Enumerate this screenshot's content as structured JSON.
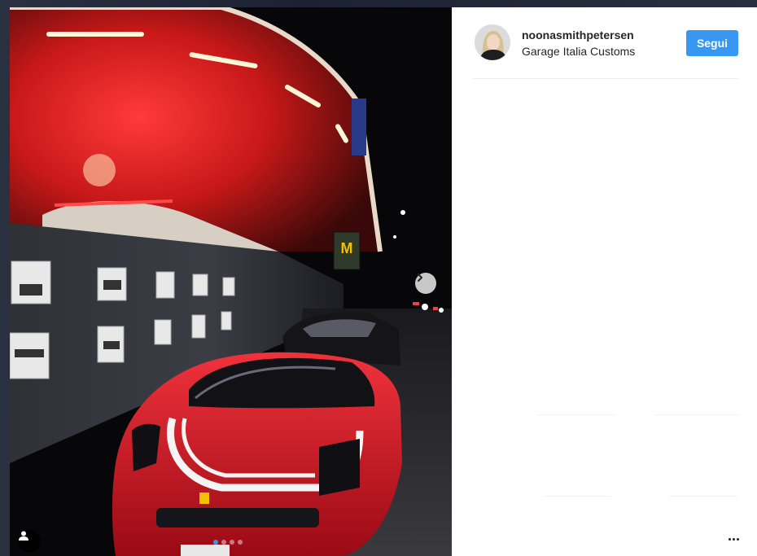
{
  "post": {
    "username": "noonasmithpetersen",
    "location": "Garage Italia Customs",
    "follow_label": "Segui"
  },
  "photo": {
    "description_icons": [
      "tag-user-icon",
      "next-arrow-icon",
      "more-options-icon"
    ],
    "carousel": {
      "total": 4,
      "active_index": 0
    },
    "sign_text": "M"
  },
  "colors": {
    "accent": "#3897f0",
    "text": "#262626",
    "awning_red": "#e02020",
    "car_red": "#d4101c"
  }
}
